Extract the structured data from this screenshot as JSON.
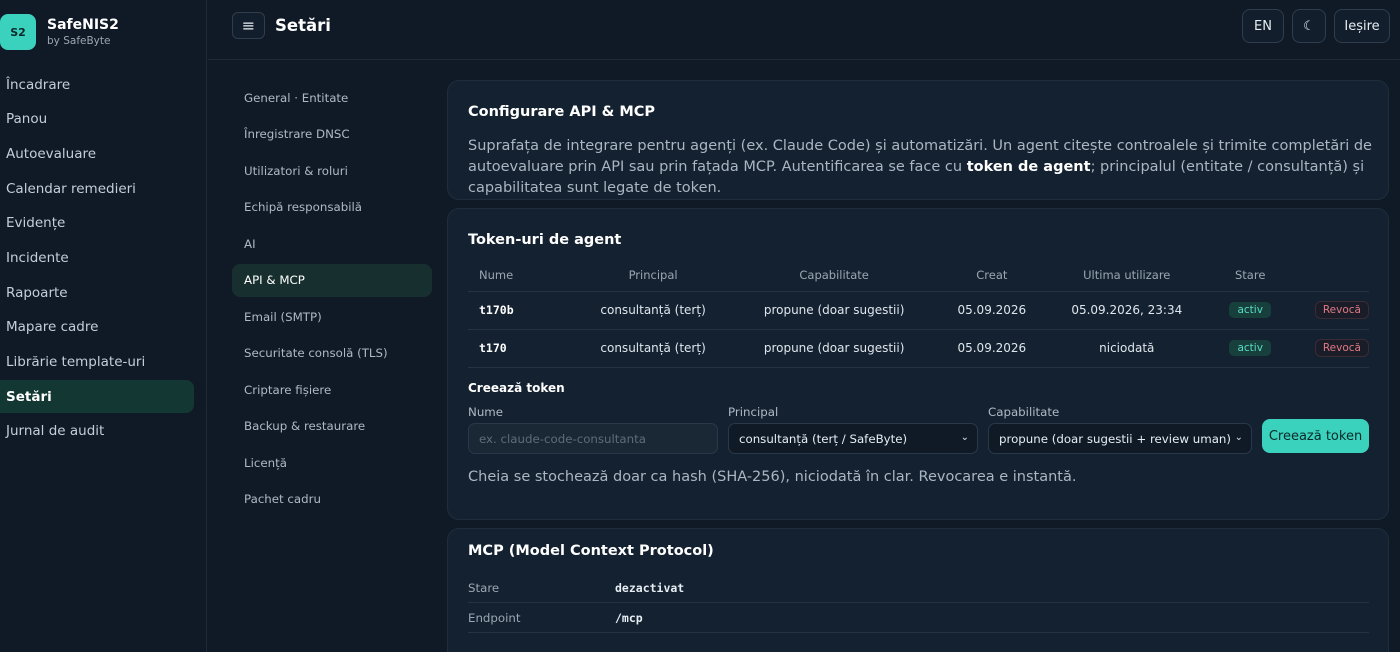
{
  "brand": {
    "logo": "S2",
    "name": "SafeNIS2",
    "sub": "by SafeByte"
  },
  "nav": [
    {
      "label": "Încadrare",
      "active": false
    },
    {
      "label": "Panou",
      "active": false
    },
    {
      "label": "Autoevaluare",
      "active": false
    },
    {
      "label": "Calendar remedieri",
      "active": false
    },
    {
      "label": "Evidențe",
      "active": false
    },
    {
      "label": "Incidente",
      "active": false
    },
    {
      "label": "Rapoarte",
      "active": false
    },
    {
      "label": "Mapare cadre",
      "active": false
    },
    {
      "label": "Librărie template-uri",
      "active": false
    },
    {
      "label": "Setări",
      "active": true
    },
    {
      "label": "Jurnal de audit",
      "active": false
    }
  ],
  "header": {
    "menu_icon": "≡",
    "title": "Setări",
    "lang": "EN",
    "theme_icon": "☾",
    "logout": "Ieșire"
  },
  "subnav": [
    {
      "label": "General · Entitate",
      "active": false
    },
    {
      "label": "Înregistrare DNSC",
      "active": false
    },
    {
      "label": "Utilizatori & roluri",
      "active": false
    },
    {
      "label": "Echipă responsabilă",
      "active": false
    },
    {
      "label": "AI",
      "active": false
    },
    {
      "label": "API & MCP",
      "active": true
    },
    {
      "label": "Email (SMTP)",
      "active": false
    },
    {
      "label": "Securitate consolă (TLS)",
      "active": false
    },
    {
      "label": "Criptare fișiere",
      "active": false
    },
    {
      "label": "Backup & restaurare",
      "active": false
    },
    {
      "label": "Licență",
      "active": false
    },
    {
      "label": "Pachet cadru",
      "active": false
    }
  ],
  "api_card": {
    "title": "Configurare API & MCP",
    "desc_part1": "Suprafața de integrare pentru agenți (ex. Claude Code) și automatizări. Un agent citește controalele și trimite completări de autoevaluare prin API sau prin fațada MCP. Autentificarea se face cu ",
    "desc_bold": "token de agent",
    "desc_part2": "; principalul (entitate / consultanță) și capabilitatea sunt legate de token."
  },
  "tokens_card": {
    "title": "Token-uri de agent",
    "columns": [
      "Nume",
      "Principal",
      "Capabilitate",
      "Creat",
      "Ultima utilizare",
      "Stare",
      ""
    ],
    "rows": [
      {
        "name": "t170b",
        "principal": "consultanță (terț)",
        "capability": "propune (doar sugestii)",
        "created": "05.09.2026",
        "last_used": "05.09.2026, 23:34",
        "status": "activ",
        "action": "Revocă"
      },
      {
        "name": "t170",
        "principal": "consultanță (terț)",
        "capability": "propune (doar sugestii)",
        "created": "05.09.2026",
        "last_used": "niciodată",
        "status": "activ",
        "action": "Revocă"
      }
    ],
    "create": {
      "title": "Creează token",
      "name_label": "Nume",
      "name_placeholder": "ex. claude-code-consultanta",
      "principal_label": "Principal",
      "principal_value": "consultanță (terț / SafeByte)",
      "capability_label": "Capabilitate",
      "capability_value": "propune (doar sugestii + review uman)",
      "button": "Creează token"
    },
    "note": "Cheia se stochează doar ca hash (SHA-256), niciodată în clar. Revocarea e instantă."
  },
  "mcp_card": {
    "title": "MCP (Model Context Protocol)",
    "rows": [
      {
        "key": "Stare",
        "value": "dezactivat"
      },
      {
        "key": "Endpoint",
        "value": "/mcp"
      }
    ]
  },
  "colors": {
    "accent": "#3ad1bd",
    "background": "#0f1a26",
    "card": "#142130",
    "danger": "#e07a84"
  }
}
